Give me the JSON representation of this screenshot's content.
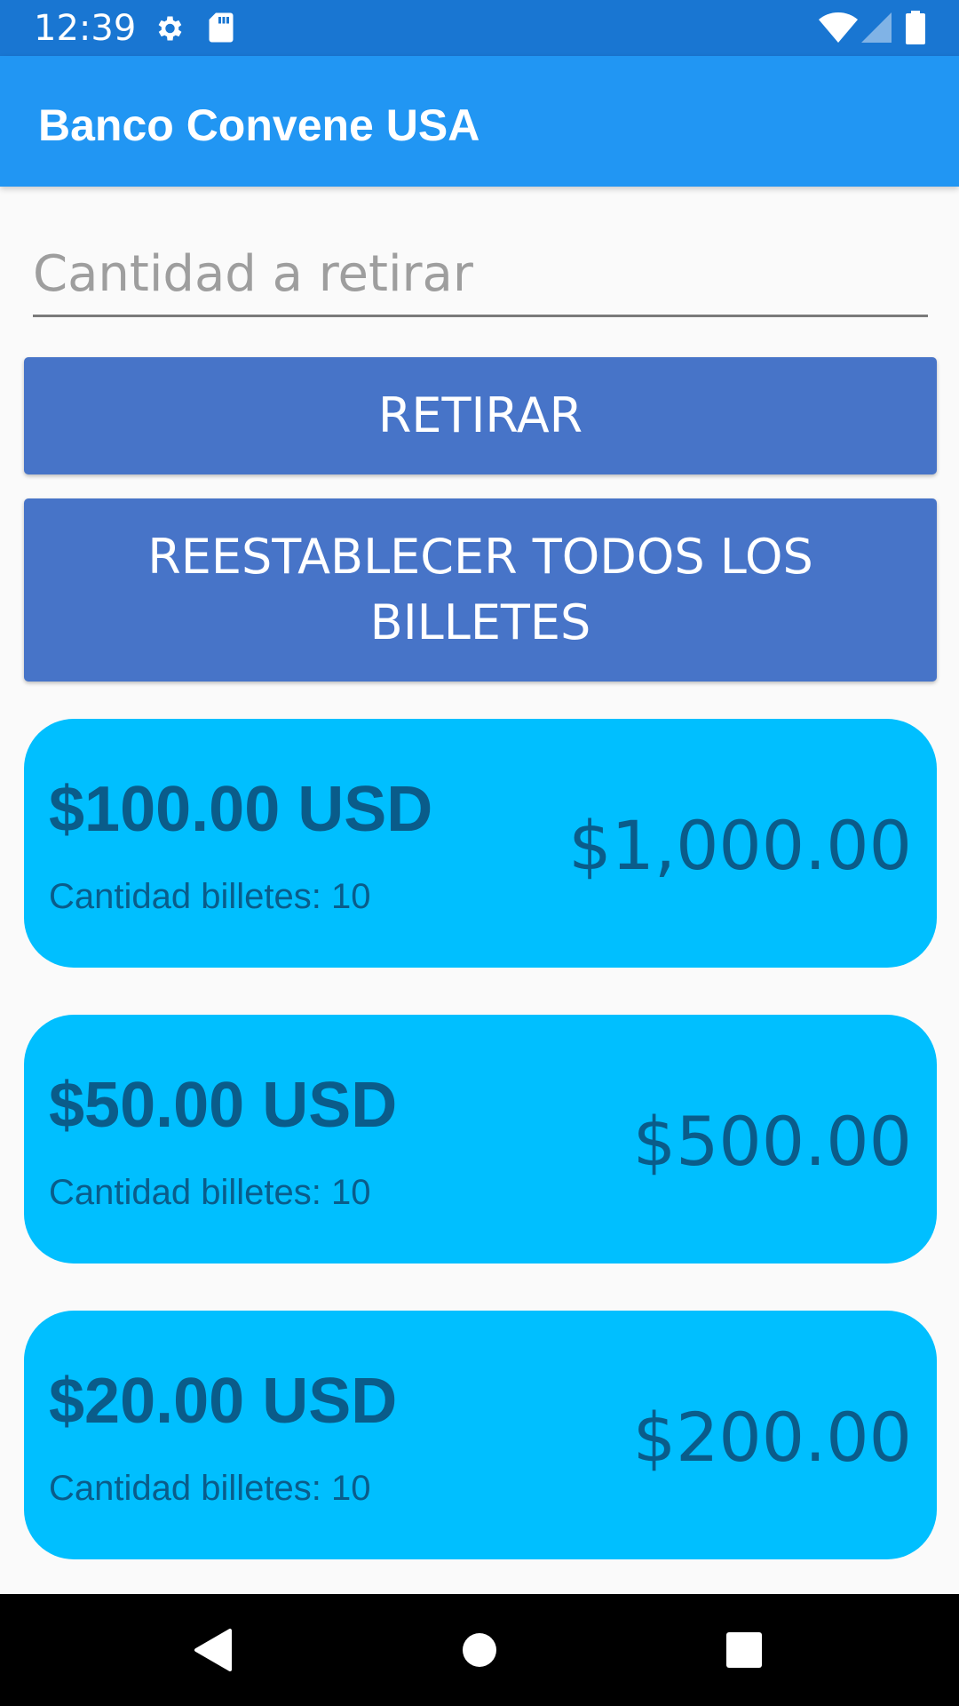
{
  "status_bar": {
    "time": "12:39",
    "icons": [
      "gear-icon",
      "sd-card-icon",
      "wifi-icon",
      "signal-icon",
      "battery-icon"
    ]
  },
  "app_bar": {
    "title": "Banco Convene USA",
    "color": "#2196F3"
  },
  "form": {
    "amount_placeholder": "Cantidad a retirar",
    "amount_value": "",
    "withdraw_label": "RETIRAR",
    "reset_label": "REESTABLECER TODOS LOS BILLETES",
    "button_color": "#4774C8"
  },
  "bills": [
    {
      "denomination": "$100.00 USD",
      "count_text": "Cantidad billetes: 10",
      "total": "$1,000.00"
    },
    {
      "denomination": "$50.00 USD",
      "count_text": "Cantidad billetes: 10",
      "total": "$500.00"
    },
    {
      "denomination": "$20.00 USD",
      "count_text": "Cantidad billetes: 10",
      "total": "$200.00"
    }
  ],
  "card_color": "#00BFFF",
  "nav_bar": {
    "icons": [
      "back-icon",
      "home-icon",
      "recents-icon"
    ]
  }
}
